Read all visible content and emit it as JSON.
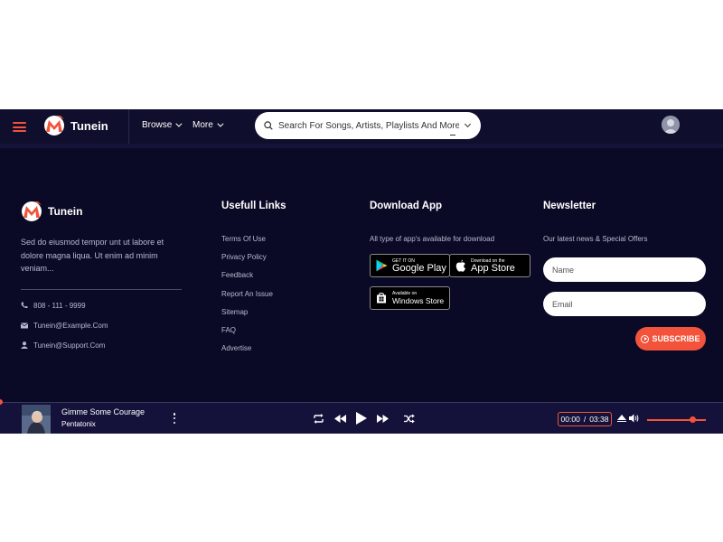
{
  "header": {
    "brand": "Tunein",
    "nav": [
      {
        "label": "Browse"
      },
      {
        "label": "More"
      }
    ],
    "search_placeholder": "Search For Songs, Artists, Playlists And More.."
  },
  "footer": {
    "brand": "Tunein",
    "description": "Sed do eiusmod tempor unt ut labore et dolore magna liqua. Ut enim ad minim veniam...",
    "contacts": [
      {
        "icon": "phone-icon",
        "text": "808 - 111 - 9999"
      },
      {
        "icon": "mail-icon",
        "text": "Tunein@Example.Com"
      },
      {
        "icon": "user-icon",
        "text": "Tunein@Support.Com"
      }
    ],
    "links_title": "Usefull Links",
    "links": [
      {
        "label": "Terms Of Use"
      },
      {
        "label": "Privacy Policy"
      },
      {
        "label": "Feedback"
      },
      {
        "label": "Report An Issue"
      },
      {
        "label": "Sitemap"
      },
      {
        "label": "FAQ"
      },
      {
        "label": "Advertise"
      }
    ],
    "download_title": "Download App",
    "download_text": "All type of app's available for download",
    "stores": {
      "google": {
        "small": "GET IT ON",
        "big": "Google Play"
      },
      "apple": {
        "small": "Download on the",
        "big": "App Store"
      },
      "windows": {
        "small": "Available on",
        "big": "Windows Store"
      }
    },
    "newsletter_title": "Newsletter",
    "newsletter_text": "Our latest news & Special Offers",
    "name_placeholder": "Name",
    "email_placeholder": "Email",
    "subscribe_label": "SUBSCRIBE"
  },
  "player": {
    "title": "Gimme Some Courage",
    "artist": "Pentatonix",
    "current_time": "00:00",
    "time_sep": "/",
    "total_time": "03:38",
    "progress": 0,
    "volume_percent": 78
  },
  "colors": {
    "accent": "#f2533a",
    "background": "#0b0a26",
    "header": "#0f0e2c",
    "player": "#14123a"
  }
}
